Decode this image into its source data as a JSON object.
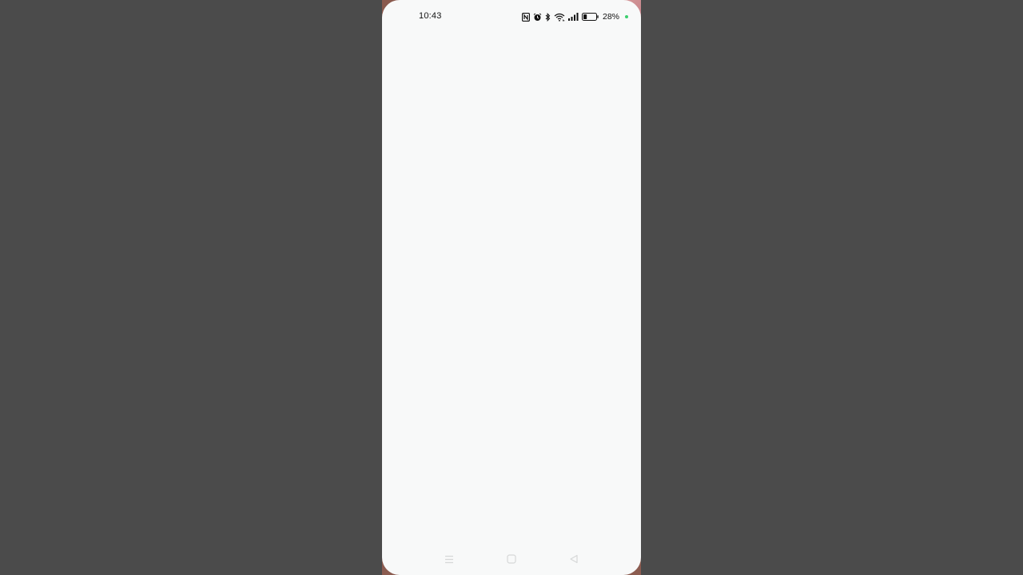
{
  "status_bar": {
    "time": "10:43",
    "battery_percent": "28%",
    "icons": [
      "nfc-icon",
      "alarm-icon",
      "bluetooth-icon",
      "wifi-icon",
      "signal-icon",
      "battery-icon"
    ],
    "battery_level": 0.28,
    "indicator_color": "#3ccf6e"
  },
  "navigation": {
    "buttons": [
      "menu-button",
      "home-button",
      "back-button"
    ]
  },
  "colors": {
    "outer_background": "#4b4b4b",
    "screen_background": "#f8f9f9"
  }
}
